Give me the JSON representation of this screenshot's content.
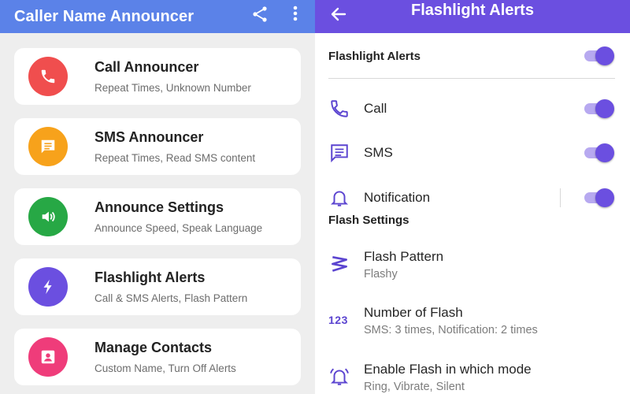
{
  "left_panel": {
    "app_title": "Caller Name Announcer",
    "cards": [
      {
        "title": "Call Announcer",
        "subtitle": "Repeat Times, Unknown Number",
        "color": "#f04e4e",
        "icon": "phone-icon"
      },
      {
        "title": "SMS Announcer",
        "subtitle": "Repeat Times, Read SMS content",
        "color": "#f7a21b",
        "icon": "message-icon"
      },
      {
        "title": "Announce Settings",
        "subtitle": "Announce Speed, Speak Language",
        "color": "#27a845",
        "icon": "speaker-icon"
      },
      {
        "title": "Flashlight Alerts",
        "subtitle": "Call & SMS Alerts, Flash Pattern",
        "color": "#6b4fe0",
        "icon": "flash-icon"
      },
      {
        "title": "Manage Contacts",
        "subtitle": "Custom Name, Turn Off Alerts",
        "color": "#ef3c7a",
        "icon": "person-icon"
      }
    ]
  },
  "right_panel": {
    "title": "Flashlight Alerts",
    "master_toggle_label": "Flashlight Alerts",
    "alert_rows": [
      {
        "label": "Call",
        "icon": "phone-icon",
        "enabled": true
      },
      {
        "label": "SMS",
        "icon": "message-icon",
        "enabled": true
      },
      {
        "label": "Notification",
        "icon": "bell-icon",
        "enabled": true
      }
    ],
    "section_title": "Flash Settings",
    "settings_rows": [
      {
        "label": "Flash Pattern",
        "value": "Flashy",
        "icon": "film-icon"
      },
      {
        "label": "Number of Flash",
        "value": "SMS: 3 times, Notification: 2 times",
        "icon": "123",
        "icon_text": "123"
      },
      {
        "label": "Enable Flash in which mode",
        "value": "Ring, Vibrate, Silent",
        "icon": "bell-ring-icon"
      }
    ],
    "accent_color": "#6b4fe0"
  },
  "colors": {
    "left_bar": "#5b82e8",
    "right_bar": "#6b4fe0"
  }
}
